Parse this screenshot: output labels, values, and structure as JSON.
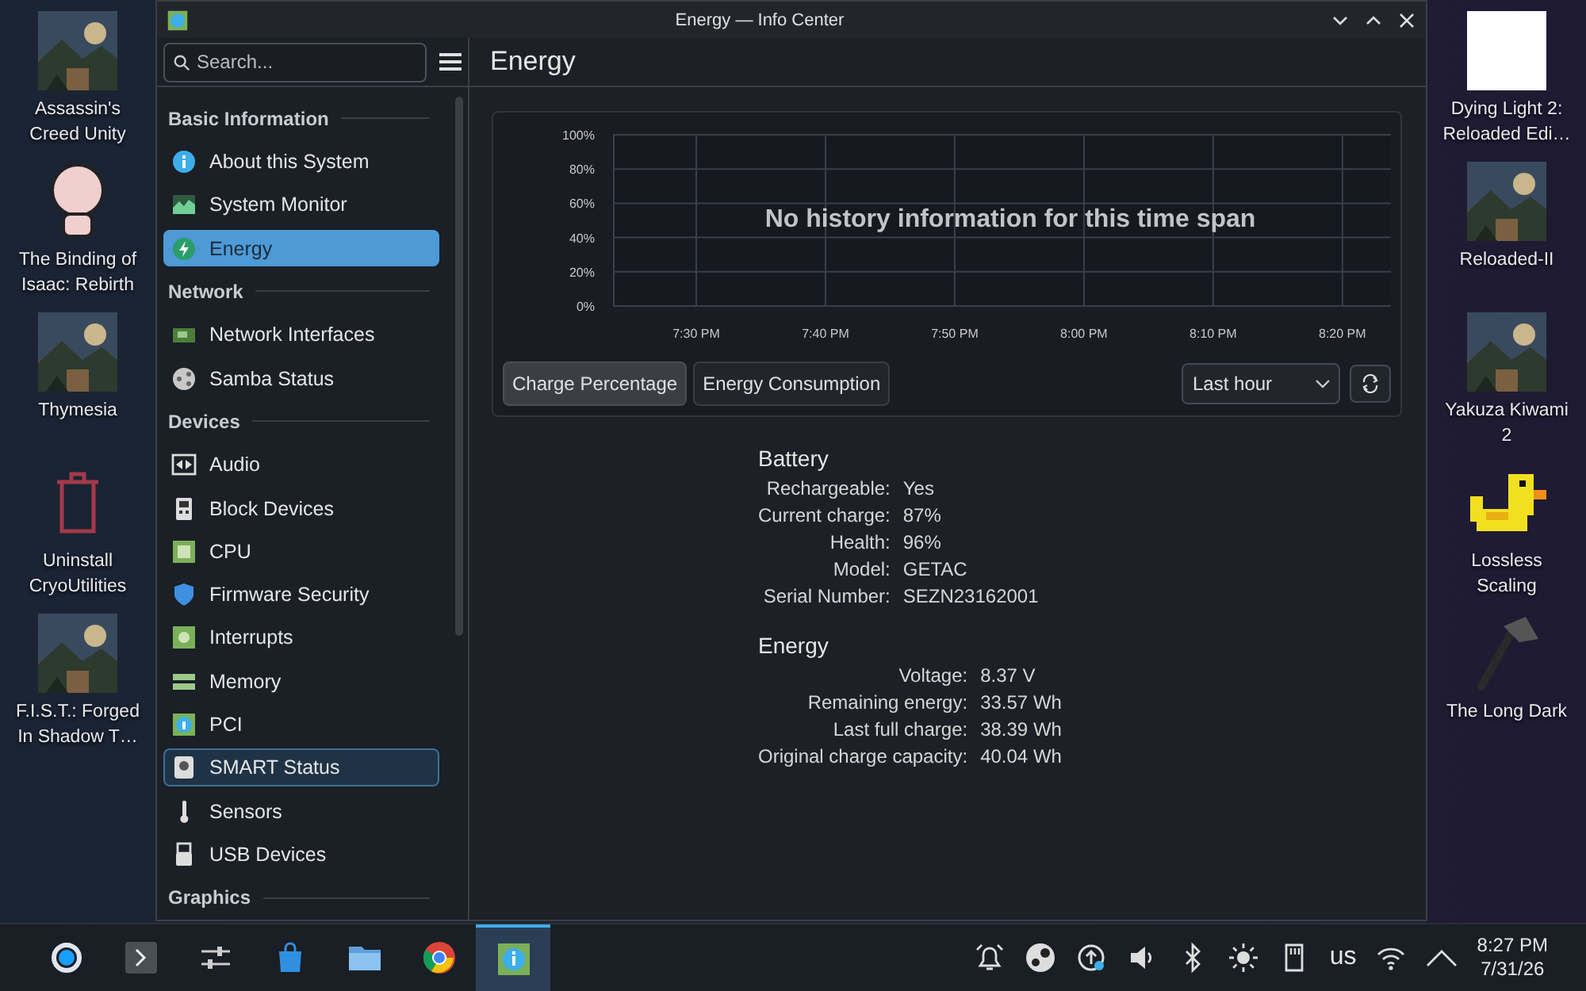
{
  "desktop_left": [
    {
      "label": "Assassin's Creed Unity",
      "kind": "picture"
    },
    {
      "label": "The Binding of Isaac: Rebirth",
      "kind": "figure"
    },
    {
      "label": "Thymesia",
      "kind": "picture"
    },
    {
      "label": "Uninstall CryoUtilities",
      "kind": "trash"
    },
    {
      "label": "F.I.S.T.: Forged In Shadow T…",
      "kind": "picture"
    }
  ],
  "window": {
    "title": "Energy — Info Center",
    "search": {
      "placeholder": "Search..."
    },
    "sidebar": {
      "sections": [
        {
          "title": "Basic Information",
          "items": [
            {
              "label": "About this System",
              "selected": false,
              "hovered": false
            },
            {
              "label": "System Monitor",
              "selected": false,
              "hovered": false
            },
            {
              "label": "Energy",
              "selected": true,
              "hovered": false
            }
          ]
        },
        {
          "title": "Network",
          "items": [
            {
              "label": "Network Interfaces",
              "selected": false,
              "hovered": false
            },
            {
              "label": "Samba Status",
              "selected": false,
              "hovered": false
            }
          ]
        },
        {
          "title": "Devices",
          "items": [
            {
              "label": "Audio",
              "selected": false,
              "hovered": false
            },
            {
              "label": "Block Devices",
              "selected": false,
              "hovered": false
            },
            {
              "label": "CPU",
              "selected": false,
              "hovered": false
            },
            {
              "label": "Firmware Security",
              "selected": false,
              "hovered": false
            },
            {
              "label": "Interrupts",
              "selected": false,
              "hovered": false
            },
            {
              "label": "Memory",
              "selected": false,
              "hovered": false
            },
            {
              "label": "PCI",
              "selected": false,
              "hovered": false
            },
            {
              "label": "SMART Status",
              "selected": false,
              "hovered": true
            },
            {
              "label": "Sensors",
              "selected": false,
              "hovered": false
            },
            {
              "label": "USB Devices",
              "selected": false,
              "hovered": false
            }
          ]
        },
        {
          "title": "Graphics"
        }
      ]
    },
    "page_title": "Energy",
    "chart": {
      "message": "No history information for this time span",
      "chart_data": {
        "type": "line",
        "ylim": [
          0,
          100
        ],
        "grid": true,
        "yticks": [
          {
            "value": 100,
            "label": "100%"
          },
          {
            "value": 80,
            "label": "80%"
          },
          {
            "value": 60,
            "label": "60%"
          },
          {
            "value": 40,
            "label": "40%"
          },
          {
            "value": 20,
            "label": "20%"
          },
          {
            "value": 0,
            "label": "0%"
          }
        ],
        "categories": [
          "7:30 PM",
          "7:40 PM",
          "7:50 PM",
          "8:00 PM",
          "8:10 PM",
          "8:20 PM"
        ]
      }
    },
    "chart_tabs": [
      {
        "label": "Charge Percentage",
        "selected": true
      },
      {
        "label": "Energy Consumption",
        "selected": false
      }
    ],
    "range": {
      "value": "Last hour"
    },
    "details": [
      {
        "title": "Battery",
        "rows": [
          {
            "label": "Rechargeable:",
            "value": "Yes"
          },
          {
            "label": "Current charge:",
            "value": "87%"
          },
          {
            "label": "Health:",
            "value": "96%"
          },
          {
            "label": "Model:",
            "value": "GETAC"
          },
          {
            "label": "Serial Number:",
            "value": "SEZN23162001"
          }
        ]
      },
      {
        "title": "Energy",
        "rows": [
          {
            "label": "Voltage:",
            "value": "8.37 V"
          },
          {
            "label": "Remaining energy:",
            "value": "33.57 Wh"
          },
          {
            "label": "Last full charge:",
            "value": "38.39 Wh"
          },
          {
            "label": "Original charge capacity:",
            "value": "40.04 Wh"
          }
        ]
      }
    ]
  },
  "desktop_right": [
    {
      "label": "Dying Light 2: Reloaded Edi…",
      "kind": "blank"
    },
    {
      "label": "Reloaded-II",
      "kind": "picture"
    },
    {
      "label": "Yakuza Kiwami 2",
      "kind": "picture"
    },
    {
      "label": "Lossless Scaling",
      "kind": "duck"
    },
    {
      "label": "The Long Dark",
      "kind": "axe"
    }
  ],
  "taskbar": {
    "apps": [
      {
        "kind": "launcher",
        "selected": false
      },
      {
        "kind": "terminal",
        "selected": false
      },
      {
        "kind": "mixer",
        "selected": false
      },
      {
        "kind": "store",
        "selected": false
      },
      {
        "kind": "files",
        "selected": false
      },
      {
        "kind": "browser",
        "selected": false
      },
      {
        "kind": "info",
        "selected": true
      }
    ],
    "tray": [
      {
        "kind": "bell"
      },
      {
        "kind": "game"
      },
      {
        "kind": "update"
      },
      {
        "kind": "volume"
      },
      {
        "kind": "bluetooth"
      },
      {
        "kind": "brightness"
      },
      {
        "kind": "sdcard"
      },
      {
        "kind": "text",
        "label": "us"
      },
      {
        "kind": "wifi"
      },
      {
        "kind": "caret"
      }
    ],
    "clock": {
      "time": "8:27 PM",
      "date": "7/31/26"
    }
  }
}
